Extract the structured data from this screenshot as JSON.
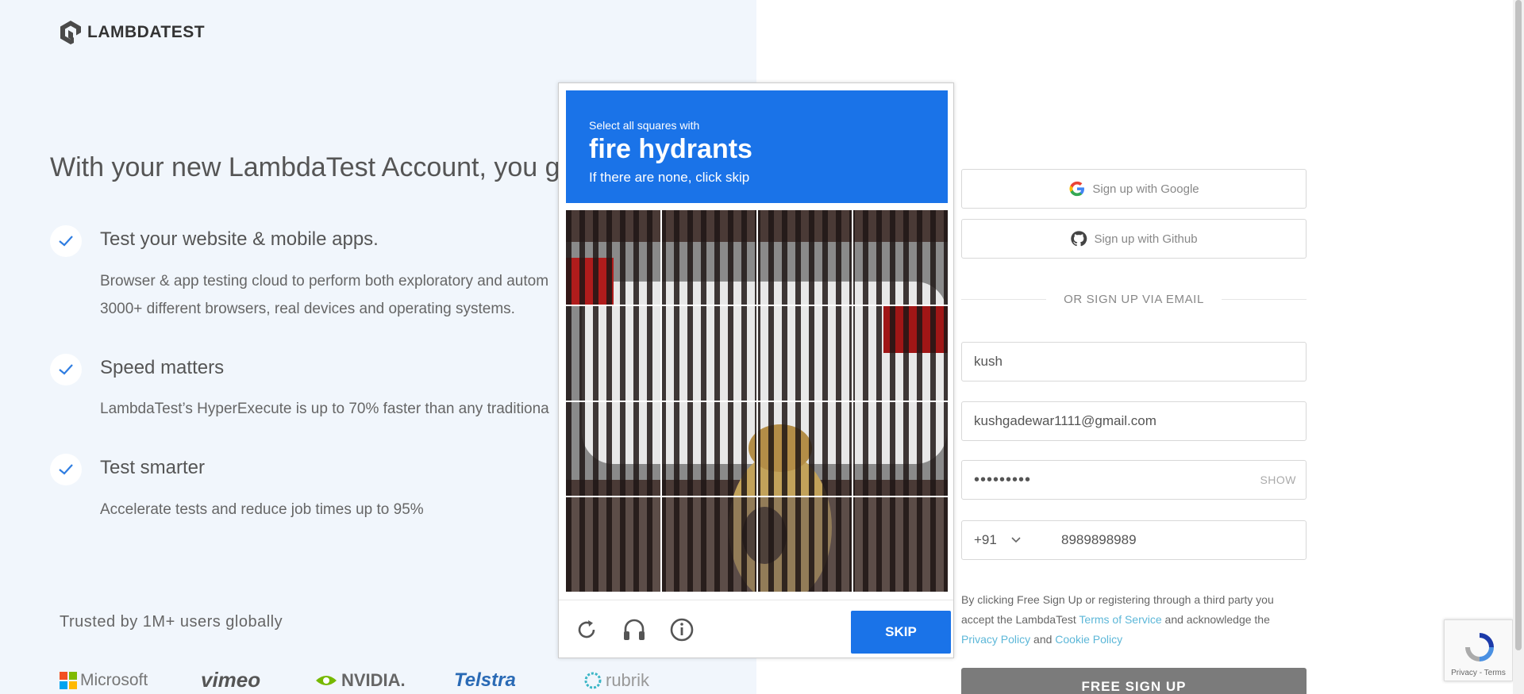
{
  "brand": {
    "name": "LAMBDATEST"
  },
  "hero": {
    "headline": "With your new LambdaTest Account, you get",
    "features": [
      {
        "title": "Test your website & mobile apps.",
        "desc1": "Browser & app testing cloud to perform both exploratory and autom",
        "desc2": "3000+ different browsers, real devices and operating systems."
      },
      {
        "title": "Speed matters",
        "desc1": "LambdaTest’s HyperExecute is up to 70% faster than any traditiona"
      },
      {
        "title": "Test smarter",
        "desc1": "Accelerate tests and reduce job times up to 95%"
      }
    ],
    "trusted": "Trusted by 1M+ users globally",
    "logos": [
      "Microsoft",
      "vimeo",
      "NVIDIA.",
      "Telstra",
      "rubrik"
    ]
  },
  "signup": {
    "google": "Sign up with Google",
    "github": "Sign up with Github",
    "or_email": "OR SIGN UP VIA EMAIL",
    "name_value": "kush",
    "email_value": "kushgadewar1111@gmail.com",
    "password_mask": "•••••••••",
    "show_label": "SHOW",
    "country_code": "+91",
    "phone_value": "8989898989",
    "legal_1": "By clicking Free Sign Up or registering through a third party you accept the LambdaTest ",
    "terms": "Terms of Service",
    "legal_2": " and acknowledge the ",
    "privacy": "Privacy Policy",
    "and": " and ",
    "cookie": "Cookie Policy",
    "submit": "FREE SIGN UP"
  },
  "recaptcha": {
    "links": "Privacy - Terms"
  },
  "captcha": {
    "prompt_small": "Select all squares with",
    "prompt_target": "fire hydrants",
    "prompt_sub": "If there are none, click skip",
    "skip_label": "SKIP",
    "icons": [
      "reload-icon",
      "audio-icon",
      "info-icon"
    ]
  },
  "colors": {
    "captcha_blue": "#1a73e8",
    "left_bg": "#f1f6fc",
    "check": "#2f7de1",
    "link": "#5cb7d8"
  }
}
